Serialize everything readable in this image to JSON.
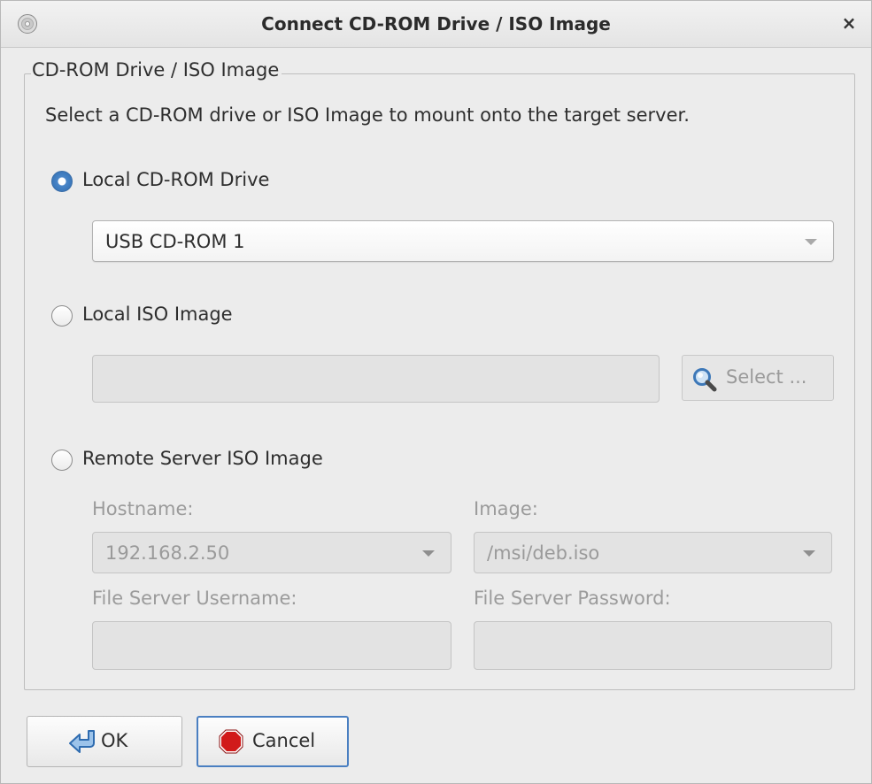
{
  "window": {
    "title": "Connect CD-ROM Drive / ISO Image",
    "close_symbol": "×"
  },
  "group": {
    "legend": "CD-ROM Drive / ISO Image",
    "instruction": "Select a CD-ROM drive or ISO Image to mount onto the target server."
  },
  "local_cdrom": {
    "label": "Local CD-ROM Drive",
    "selected": true,
    "drive_value": "USB CD-ROM 1"
  },
  "local_iso": {
    "label": "Local ISO Image",
    "selected": false,
    "path_value": "",
    "select_button_label": "Select ..."
  },
  "remote_iso": {
    "label": "Remote Server ISO Image",
    "selected": false,
    "hostname_label": "Hostname:",
    "hostname_value": "192.168.2.50",
    "image_label": "Image:",
    "image_value": "/msi/deb.iso",
    "username_label": "File Server Username:",
    "username_value": "",
    "password_label": "File Server Password:",
    "password_value": ""
  },
  "buttons": {
    "ok_label": "OK",
    "cancel_label": "Cancel"
  },
  "icons": {
    "window": "cd-disc-icon",
    "select": "magnifier-icon",
    "ok": "return-arrow-icon",
    "cancel": "stop-sign-icon"
  },
  "colors": {
    "radio_selected": "#2f6cb0",
    "cancel_icon": "#d11a1a",
    "ok_icon": "#4a86c8",
    "focus_border": "#4a7fc1"
  }
}
